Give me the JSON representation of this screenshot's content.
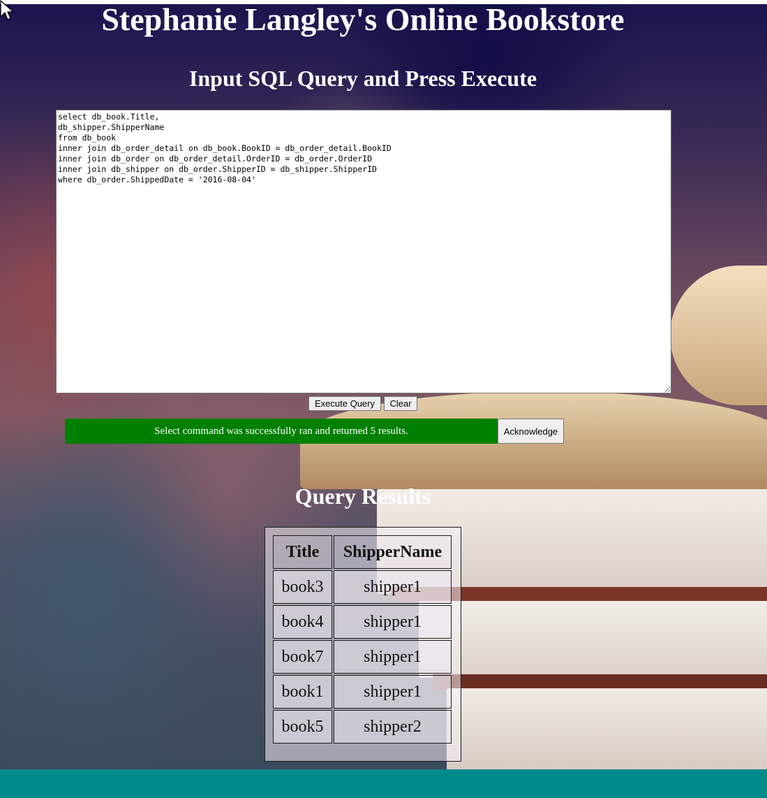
{
  "page": {
    "title": "Stephanie Langley's Online Bookstore",
    "subtitle": "Input SQL Query and Press Execute",
    "query_text": "select db_book.Title,\ndb_shipper.ShipperName\nfrom db_book\ninner join db_order_detail on db_book.BookID = db_order_detail.BookID\ninner join db_order on db_order_detail.OrderID = db_order.OrderID\ninner join db_shipper on db_order.ShipperID = db_shipper.ShipperID\nwhere db_order.ShippedDate = '2016-08-04'"
  },
  "buttons": {
    "execute": "Execute Query",
    "clear": "Clear",
    "acknowledge": "Acknowledge"
  },
  "status": {
    "message": "Select command was successfully ran and returned 5 results.",
    "color": "#008000"
  },
  "results": {
    "heading": "Query Results",
    "columns": [
      "Title",
      "ShipperName"
    ],
    "rows": [
      [
        "book3",
        "shipper1"
      ],
      [
        "book4",
        "shipper1"
      ],
      [
        "book7",
        "shipper1"
      ],
      [
        "book1",
        "shipper1"
      ],
      [
        "book5",
        "shipper2"
      ]
    ]
  },
  "colors": {
    "footer_bar": "#008b8b",
    "text": "#ffffff"
  },
  "icons": {
    "cursor": "mouse-pointer-icon"
  }
}
